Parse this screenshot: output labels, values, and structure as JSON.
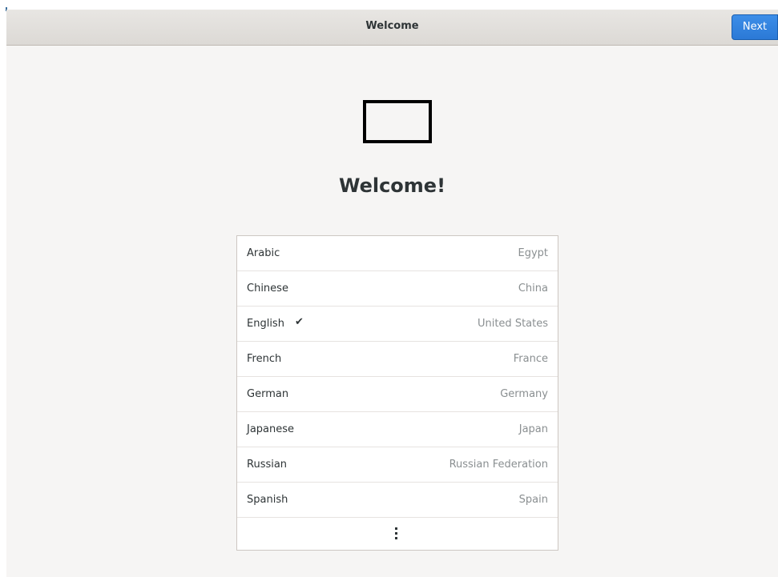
{
  "window": {
    "title": "Welcome",
    "next_label": "Next"
  },
  "main": {
    "heading": "Welcome!",
    "logo_icon": "window-outline-icon"
  },
  "languages": [
    {
      "name": "Arabic",
      "region": "Egypt",
      "selected": false
    },
    {
      "name": "Chinese",
      "region": "China",
      "selected": false
    },
    {
      "name": "English",
      "region": "United States",
      "selected": true
    },
    {
      "name": "French",
      "region": "France",
      "selected": false
    },
    {
      "name": "German",
      "region": "Germany",
      "selected": false
    },
    {
      "name": "Japanese",
      "region": "Japan",
      "selected": false
    },
    {
      "name": "Russian",
      "region": "Russian Federation",
      "selected": false
    },
    {
      "name": "Spanish",
      "region": "Spain",
      "selected": false
    }
  ],
  "more_icon": "vertical-ellipsis-icon",
  "check_glyph": "✔",
  "colors": {
    "accent": "#3584e4",
    "window_bg": "#f6f5f4",
    "secondary_text": "#8a8f91"
  }
}
